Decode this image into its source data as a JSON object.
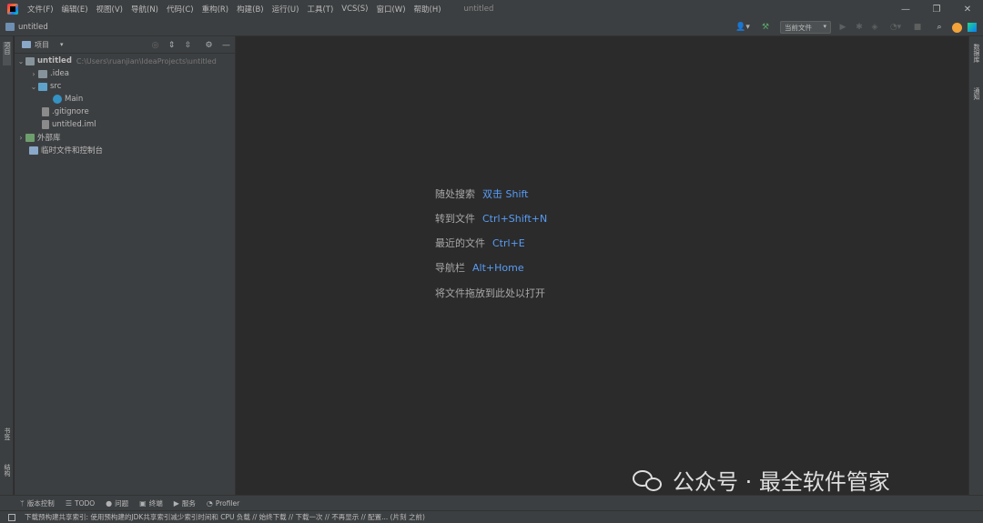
{
  "menubar": {
    "items": [
      "文件(F)",
      "编辑(E)",
      "视图(V)",
      "导航(N)",
      "代码(C)",
      "重构(R)",
      "构建(B)",
      "运行(U)",
      "工具(T)",
      "VCS(S)",
      "窗口(W)",
      "帮助(H)"
    ],
    "title": "untitled",
    "minimize": "—",
    "restore": "❐",
    "close": "✕"
  },
  "navbar": {
    "project": "untitled",
    "run_config": "当前文件",
    "run_config_arrow": "▾"
  },
  "left_strip": {
    "project_tab": "项目",
    "bookmarks_tab": "书签",
    "structure_tab": "结构"
  },
  "right_strip": {
    "database_tab": "数据库",
    "notifications_tab": "通知"
  },
  "project_panel": {
    "title": "项目",
    "dropdown": "▾",
    "tree": {
      "root_name": "untitled",
      "root_path": "C:\\Users\\ruanjian\\IdeaProjects\\untitled",
      "idea": ".idea",
      "src": "src",
      "main": "Main",
      "gitignore": ".gitignore",
      "iml": "untitled.iml",
      "external_libs": "外部库",
      "scratches": "临时文件和控制台"
    }
  },
  "editor_hints": [
    {
      "label": "随处搜索",
      "key": "双击 Shift"
    },
    {
      "label": "转到文件",
      "key": "Ctrl+Shift+N"
    },
    {
      "label": "最近的文件",
      "key": "Ctrl+E"
    },
    {
      "label": "导航栏",
      "key": "Alt+Home"
    },
    {
      "label": "将文件拖放到此处以打开",
      "key": ""
    }
  ],
  "bottom_tools": {
    "vcs": "版本控制",
    "todo": "TODO",
    "problems": "问题",
    "terminal": "终端",
    "services": "服务",
    "profiler": "Profiler"
  },
  "status": {
    "message": "下载预构建共享索引: 使用预构建的JDK共享索引减少索引时间和 CPU 负载 // 始终下载 // 下载一次 // 不再显示 // 配置... (片刻 之前)"
  },
  "watermark": {
    "text": "公众号 · 最全软件管家"
  },
  "colors": {
    "menubar_bg": "#3c3f41",
    "editor_bg": "#2b2b2b",
    "accent_blue": "#589df6",
    "text": "#bbbbbb"
  }
}
